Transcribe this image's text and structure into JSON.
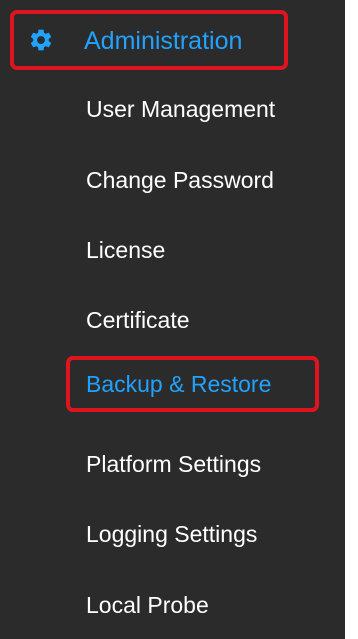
{
  "section": {
    "label": "Administration",
    "icon": "gear-icon",
    "color": "#22a2ff"
  },
  "menu": {
    "items": [
      {
        "label": "User Management",
        "active": false
      },
      {
        "label": "Change Password",
        "active": false
      },
      {
        "label": "License",
        "active": false
      },
      {
        "label": "Certificate",
        "active": false
      },
      {
        "label": "Backup & Restore",
        "active": true
      },
      {
        "label": "Platform Settings",
        "active": false
      },
      {
        "label": "Logging Settings",
        "active": false
      },
      {
        "label": "Local Probe",
        "active": false
      }
    ]
  },
  "colors": {
    "sidebar_background": "#2b2b2b",
    "highlight_border": "#e0141e",
    "active_text": "#22a2ff",
    "default_text": "#ffffff"
  }
}
